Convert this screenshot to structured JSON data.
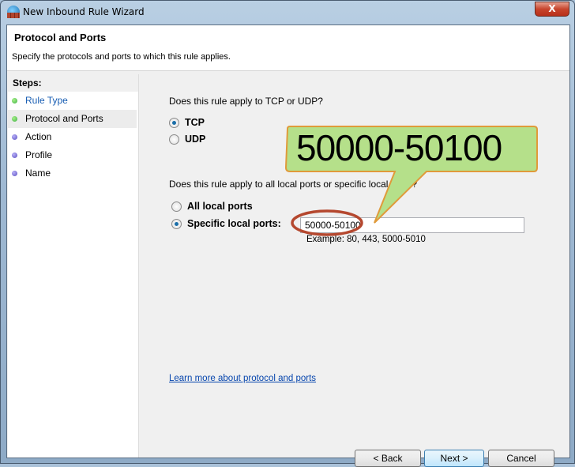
{
  "window": {
    "title": "New Inbound Rule Wizard",
    "close_label": "X"
  },
  "header": {
    "title": "Protocol and Ports",
    "subtitle": "Specify the protocols and ports to which this rule applies."
  },
  "steps": {
    "heading": "Steps:",
    "items": [
      {
        "label": "Rule Type",
        "state": "done",
        "color": "#3cb043"
      },
      {
        "label": "Protocol and Ports",
        "state": "current",
        "color": "#3cb043"
      },
      {
        "label": "Action",
        "state": "pending",
        "color": "#6a5acd"
      },
      {
        "label": "Profile",
        "state": "pending",
        "color": "#6a5acd"
      },
      {
        "label": "Name",
        "state": "pending",
        "color": "#6a5acd"
      }
    ]
  },
  "main": {
    "protocol_question": "Does this rule apply to TCP or UDP?",
    "protocols": [
      {
        "label": "TCP",
        "selected": true
      },
      {
        "label": "UDP",
        "selected": false
      }
    ],
    "ports_question": "Does this rule apply to all local ports or specific local ports?",
    "port_options": [
      {
        "label": "All local ports",
        "selected": false
      },
      {
        "label": "Specific local ports:",
        "selected": true
      }
    ],
    "ports_value": "50000-50100",
    "example": "Example: 80, 443, 5000-5010",
    "learn_more": "Learn more about protocol and ports"
  },
  "buttons": {
    "back": "< Back",
    "next": "Next >",
    "cancel": "Cancel"
  },
  "annotation": {
    "callout_text": "50000-50100",
    "callout_color": "#b5e08a",
    "ellipse_color": "#b5482f"
  }
}
